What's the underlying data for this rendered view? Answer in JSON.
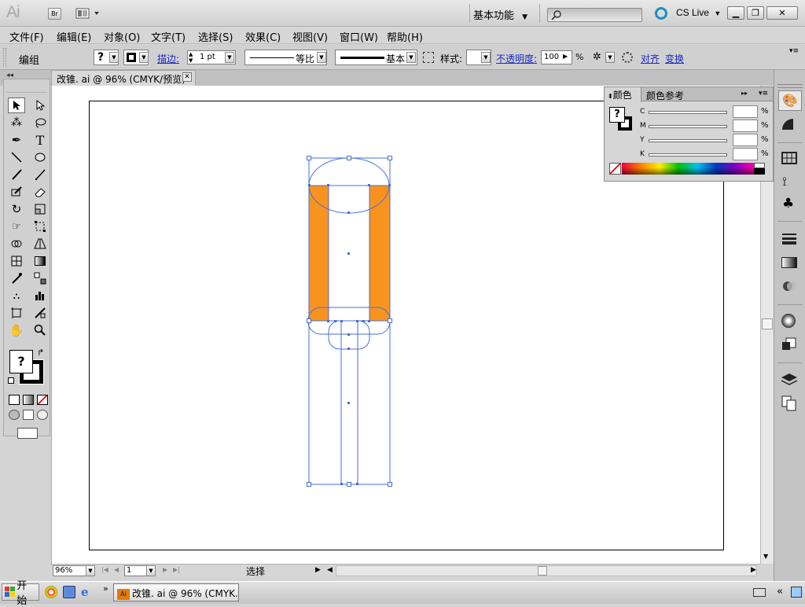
{
  "app": {
    "logo": "Ai",
    "bridge_label": "Br",
    "workspace_label": "基本功能",
    "cs_live_label": "CS Live",
    "window_buttons": [
      "minimize-icon",
      "restore-icon",
      "close-icon"
    ]
  },
  "menu": {
    "items": [
      "文件(F)",
      "编辑(E)",
      "对象(O)",
      "文字(T)",
      "选择(S)",
      "效果(C)",
      "视图(V)",
      "窗口(W)",
      "帮助(H)"
    ]
  },
  "control": {
    "selection_label": "编组",
    "fill_value": "?",
    "stroke_label": "描边:",
    "stroke_weight": "1 pt",
    "stroke_profile": "等比",
    "brush": "基本",
    "style_label": "样式:",
    "opacity_label": "不透明度:",
    "opacity_value": "100",
    "opacity_unit": "%",
    "align_label": "对齐",
    "transform_label": "变换"
  },
  "document": {
    "tab_title": "改锥. ai @ 96% (CMYK/预览)"
  },
  "color_panel": {
    "tabs": [
      "颜色",
      "颜色参考"
    ],
    "fill_value": "?",
    "channels": [
      {
        "label": "C",
        "value": "",
        "unit": "%"
      },
      {
        "label": "M",
        "value": "",
        "unit": "%"
      },
      {
        "label": "Y",
        "value": "",
        "unit": "%"
      },
      {
        "label": "K",
        "value": "",
        "unit": "%"
      }
    ]
  },
  "status": {
    "zoom": "96%",
    "page": "1",
    "tool_status": "选择"
  },
  "taskbar": {
    "start_label": "开始",
    "task_label": "改锥. ai @ 96% (CMYK..."
  },
  "colors": {
    "orange_fill": "#f7931e",
    "selection_blue": "#4a6fd8",
    "artboard": "#ffffff"
  },
  "toolbar_tools": [
    "selection-tool",
    "direct-selection-tool",
    "magic-wand-tool",
    "lasso-tool",
    "pen-tool",
    "type-tool",
    "line-tool",
    "ellipse-tool",
    "paintbrush-tool",
    "pencil-tool",
    "blob-brush-tool",
    "eraser-tool",
    "rotate-tool",
    "scale-tool",
    "warp-tool",
    "free-transform-tool",
    "shape-builder-tool",
    "perspective-grid-tool",
    "mesh-tool",
    "gradient-tool",
    "eyedropper-tool",
    "blend-tool",
    "symbol-sprayer-tool",
    "column-graph-tool",
    "artboard-tool",
    "slice-tool",
    "hand-tool",
    "zoom-tool"
  ],
  "dock_icons": [
    "color-panel-icon",
    "color-guide-icon",
    "swatches-icon",
    "brushes-icon",
    "symbols-icon",
    "stroke-icon",
    "gradient-icon",
    "transparency-icon",
    "appearance-icon",
    "graphic-styles-icon",
    "layers-icon",
    "artboards-icon"
  ]
}
